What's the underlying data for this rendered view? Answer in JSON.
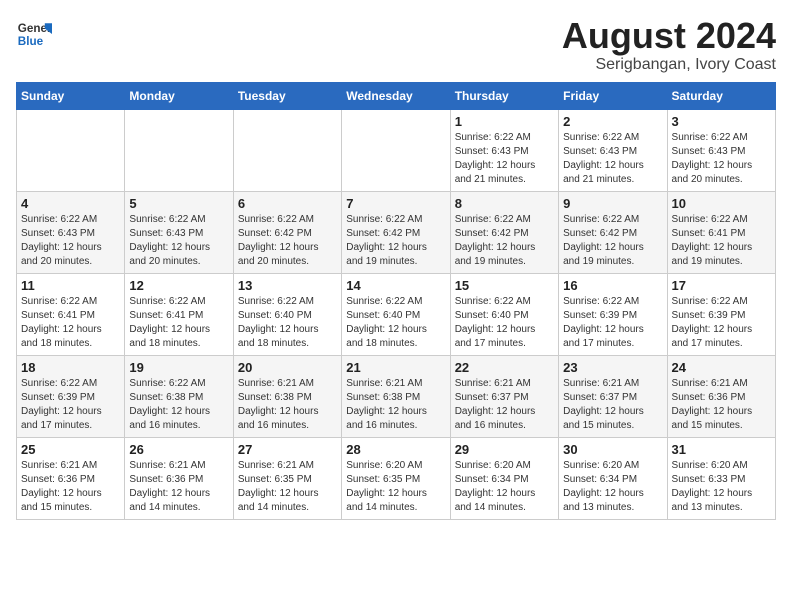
{
  "header": {
    "logo_general": "General",
    "logo_blue": "Blue",
    "month_year": "August 2024",
    "location": "Serigbangan, Ivory Coast"
  },
  "weekdays": [
    "Sunday",
    "Monday",
    "Tuesday",
    "Wednesday",
    "Thursday",
    "Friday",
    "Saturday"
  ],
  "weeks": [
    [
      {
        "day": "",
        "info": ""
      },
      {
        "day": "",
        "info": ""
      },
      {
        "day": "",
        "info": ""
      },
      {
        "day": "",
        "info": ""
      },
      {
        "day": "1",
        "info": "Sunrise: 6:22 AM\nSunset: 6:43 PM\nDaylight: 12 hours\nand 21 minutes."
      },
      {
        "day": "2",
        "info": "Sunrise: 6:22 AM\nSunset: 6:43 PM\nDaylight: 12 hours\nand 21 minutes."
      },
      {
        "day": "3",
        "info": "Sunrise: 6:22 AM\nSunset: 6:43 PM\nDaylight: 12 hours\nand 20 minutes."
      }
    ],
    [
      {
        "day": "4",
        "info": "Sunrise: 6:22 AM\nSunset: 6:43 PM\nDaylight: 12 hours\nand 20 minutes."
      },
      {
        "day": "5",
        "info": "Sunrise: 6:22 AM\nSunset: 6:43 PM\nDaylight: 12 hours\nand 20 minutes."
      },
      {
        "day": "6",
        "info": "Sunrise: 6:22 AM\nSunset: 6:42 PM\nDaylight: 12 hours\nand 20 minutes."
      },
      {
        "day": "7",
        "info": "Sunrise: 6:22 AM\nSunset: 6:42 PM\nDaylight: 12 hours\nand 19 minutes."
      },
      {
        "day": "8",
        "info": "Sunrise: 6:22 AM\nSunset: 6:42 PM\nDaylight: 12 hours\nand 19 minutes."
      },
      {
        "day": "9",
        "info": "Sunrise: 6:22 AM\nSunset: 6:42 PM\nDaylight: 12 hours\nand 19 minutes."
      },
      {
        "day": "10",
        "info": "Sunrise: 6:22 AM\nSunset: 6:41 PM\nDaylight: 12 hours\nand 19 minutes."
      }
    ],
    [
      {
        "day": "11",
        "info": "Sunrise: 6:22 AM\nSunset: 6:41 PM\nDaylight: 12 hours\nand 18 minutes."
      },
      {
        "day": "12",
        "info": "Sunrise: 6:22 AM\nSunset: 6:41 PM\nDaylight: 12 hours\nand 18 minutes."
      },
      {
        "day": "13",
        "info": "Sunrise: 6:22 AM\nSunset: 6:40 PM\nDaylight: 12 hours\nand 18 minutes."
      },
      {
        "day": "14",
        "info": "Sunrise: 6:22 AM\nSunset: 6:40 PM\nDaylight: 12 hours\nand 18 minutes."
      },
      {
        "day": "15",
        "info": "Sunrise: 6:22 AM\nSunset: 6:40 PM\nDaylight: 12 hours\nand 17 minutes."
      },
      {
        "day": "16",
        "info": "Sunrise: 6:22 AM\nSunset: 6:39 PM\nDaylight: 12 hours\nand 17 minutes."
      },
      {
        "day": "17",
        "info": "Sunrise: 6:22 AM\nSunset: 6:39 PM\nDaylight: 12 hours\nand 17 minutes."
      }
    ],
    [
      {
        "day": "18",
        "info": "Sunrise: 6:22 AM\nSunset: 6:39 PM\nDaylight: 12 hours\nand 17 minutes."
      },
      {
        "day": "19",
        "info": "Sunrise: 6:22 AM\nSunset: 6:38 PM\nDaylight: 12 hours\nand 16 minutes."
      },
      {
        "day": "20",
        "info": "Sunrise: 6:21 AM\nSunset: 6:38 PM\nDaylight: 12 hours\nand 16 minutes."
      },
      {
        "day": "21",
        "info": "Sunrise: 6:21 AM\nSunset: 6:38 PM\nDaylight: 12 hours\nand 16 minutes."
      },
      {
        "day": "22",
        "info": "Sunrise: 6:21 AM\nSunset: 6:37 PM\nDaylight: 12 hours\nand 16 minutes."
      },
      {
        "day": "23",
        "info": "Sunrise: 6:21 AM\nSunset: 6:37 PM\nDaylight: 12 hours\nand 15 minutes."
      },
      {
        "day": "24",
        "info": "Sunrise: 6:21 AM\nSunset: 6:36 PM\nDaylight: 12 hours\nand 15 minutes."
      }
    ],
    [
      {
        "day": "25",
        "info": "Sunrise: 6:21 AM\nSunset: 6:36 PM\nDaylight: 12 hours\nand 15 minutes."
      },
      {
        "day": "26",
        "info": "Sunrise: 6:21 AM\nSunset: 6:36 PM\nDaylight: 12 hours\nand 14 minutes."
      },
      {
        "day": "27",
        "info": "Sunrise: 6:21 AM\nSunset: 6:35 PM\nDaylight: 12 hours\nand 14 minutes."
      },
      {
        "day": "28",
        "info": "Sunrise: 6:20 AM\nSunset: 6:35 PM\nDaylight: 12 hours\nand 14 minutes."
      },
      {
        "day": "29",
        "info": "Sunrise: 6:20 AM\nSunset: 6:34 PM\nDaylight: 12 hours\nand 14 minutes."
      },
      {
        "day": "30",
        "info": "Sunrise: 6:20 AM\nSunset: 6:34 PM\nDaylight: 12 hours\nand 13 minutes."
      },
      {
        "day": "31",
        "info": "Sunrise: 6:20 AM\nSunset: 6:33 PM\nDaylight: 12 hours\nand 13 minutes."
      }
    ]
  ]
}
